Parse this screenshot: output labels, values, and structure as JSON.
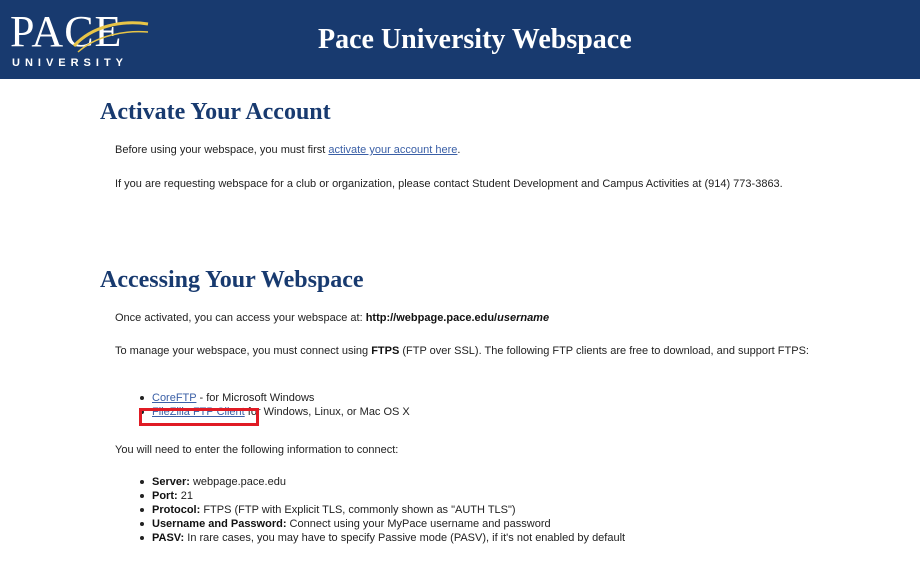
{
  "header": {
    "logo_word": "PACE",
    "logo_sub": "UNIVERSITY",
    "title": "Pace University Webspace"
  },
  "activate": {
    "heading": "Activate Your Account",
    "p1_before": "Before using your webspace, you must first ",
    "p1_link": "activate your account here",
    "p1_after": ".",
    "p2": "If you are requesting webspace for a club or organization, please contact Student Development and Campus Activities at (914) 773-3863."
  },
  "accessing": {
    "heading": "Accessing Your Webspace",
    "p1_before": "Once activated, you can access your webspace at: ",
    "p1_url": "http://webpage.pace.edu/",
    "p1_url_italic": "username",
    "p2_before": "To manage your webspace, you must connect using ",
    "p2_bold": "FTPS",
    "p2_after": " (FTP over SSL). The following FTP clients are free to download, and support FTPS:",
    "clients": [
      {
        "link": "CoreFTP",
        "text": " - for Microsoft Windows"
      },
      {
        "link": "FileZilla FTP Client",
        "text": " for Windows, Linux, or Mac OS X"
      }
    ],
    "p3": "You will need to enter the following information to connect:",
    "info": [
      {
        "label": "Server:",
        "value": " webpage.pace.edu"
      },
      {
        "label": "Port:",
        "value": " 21"
      },
      {
        "label": "Protocol:",
        "value": " FTPS (FTP with Explicit TLS, commonly shown as \"AUTH TLS\")"
      },
      {
        "label": "Username and Password:",
        "value": " Connect using your MyPace username and password"
      },
      {
        "label": "PASV:",
        "value": " In rare cases, you may have to specify Passive mode (PASV), if it's not enabled by default"
      }
    ]
  },
  "colors": {
    "header_bg": "#183a6f",
    "accent_gold": "#e8c547",
    "highlight": "#e01b24"
  }
}
